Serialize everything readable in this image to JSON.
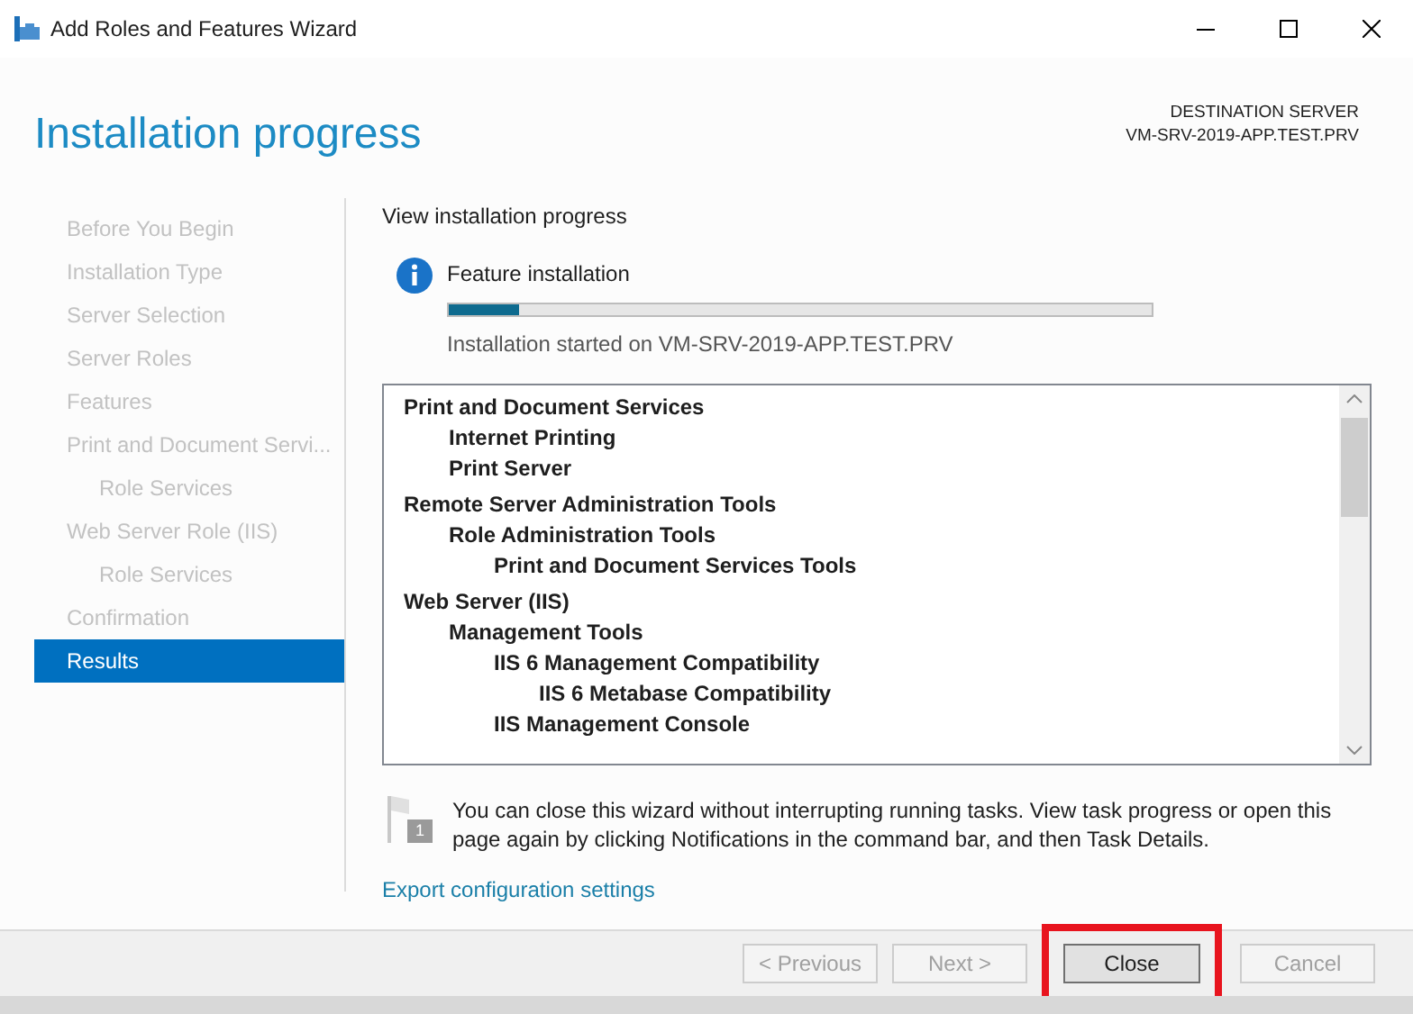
{
  "window": {
    "title": "Add Roles and Features Wizard"
  },
  "page_title": "Installation progress",
  "destination": {
    "label": "DESTINATION SERVER",
    "server": "VM-SRV-2019-APP.TEST.PRV"
  },
  "sidebar": {
    "items": [
      {
        "label": "Before You Begin",
        "selected": false
      },
      {
        "label": "Installation Type",
        "selected": false
      },
      {
        "label": "Server Selection",
        "selected": false
      },
      {
        "label": "Server Roles",
        "selected": false
      },
      {
        "label": "Features",
        "selected": false
      },
      {
        "label": "Print and Document Servi...",
        "selected": false,
        "children": [
          {
            "label": "Role Services",
            "selected": false
          }
        ]
      },
      {
        "label": "Web Server Role (IIS)",
        "selected": false,
        "children": [
          {
            "label": "Role Services",
            "selected": false
          }
        ]
      },
      {
        "label": "Confirmation",
        "selected": false
      },
      {
        "label": "Results",
        "selected": true
      }
    ]
  },
  "content": {
    "heading": "View installation progress",
    "status": {
      "title": "Feature installation",
      "level": 0.1,
      "message": "Installation started on VM-SRV-2019-APP.TEST.PRV"
    },
    "features": [
      {
        "label": "Print and Document Services",
        "children": [
          {
            "label": "Internet Printing"
          },
          {
            "label": "Print Server"
          }
        ]
      },
      {
        "label": "Remote Server Administration Tools",
        "children": [
          {
            "label": "Role Administration Tools",
            "children": [
              {
                "label": "Print and Document Services Tools"
              }
            ]
          }
        ]
      },
      {
        "label": "Web Server (IIS)",
        "children": [
          {
            "label": "Management Tools",
            "children": [
              {
                "label": "IIS 6 Management Compatibility",
                "children": [
                  {
                    "label": "IIS 6 Metabase Compatibility"
                  }
                ]
              },
              {
                "label": "IIS Management Console"
              }
            ]
          }
        ]
      }
    ],
    "note": {
      "badge": "1",
      "text": "You can close this wizard without interrupting running tasks. View task progress or open this page again by clicking Notifications in the command bar, and then Task Details."
    },
    "export_link": "Export configuration settings"
  },
  "buttons": [
    {
      "label": "< Previous",
      "disabled": true,
      "highlighted": false
    },
    {
      "label": "Next >",
      "disabled": true,
      "highlighted": false
    },
    {
      "label": "Close",
      "disabled": false,
      "highlighted": true
    },
    {
      "label": "Cancel",
      "disabled": true,
      "highlighted": false
    }
  ]
}
